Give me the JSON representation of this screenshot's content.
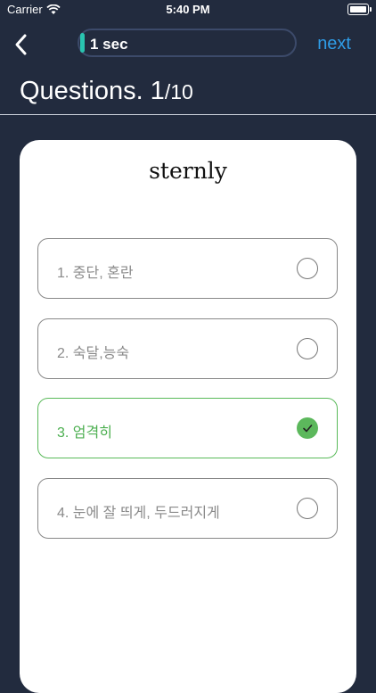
{
  "status_bar": {
    "carrier": "Carrier",
    "time": "5:40 PM"
  },
  "header": {
    "timer_text": "1 sec",
    "next_label": "next",
    "title_main": "Questions. 1",
    "title_total": "/10"
  },
  "question": {
    "word": "sternly"
  },
  "options": [
    {
      "label": "1. 중단, 혼란",
      "selected": false
    },
    {
      "label": "2. 숙달,능숙",
      "selected": false
    },
    {
      "label": "3. 엄격히",
      "selected": true
    },
    {
      "label": "4. 눈에 잘 띄게, 두드러지게",
      "selected": false
    }
  ],
  "colors": {
    "background": "#222b3e",
    "accent": "#2f9ce6",
    "timer": "#29c4b0",
    "correct": "#5cb85c"
  }
}
